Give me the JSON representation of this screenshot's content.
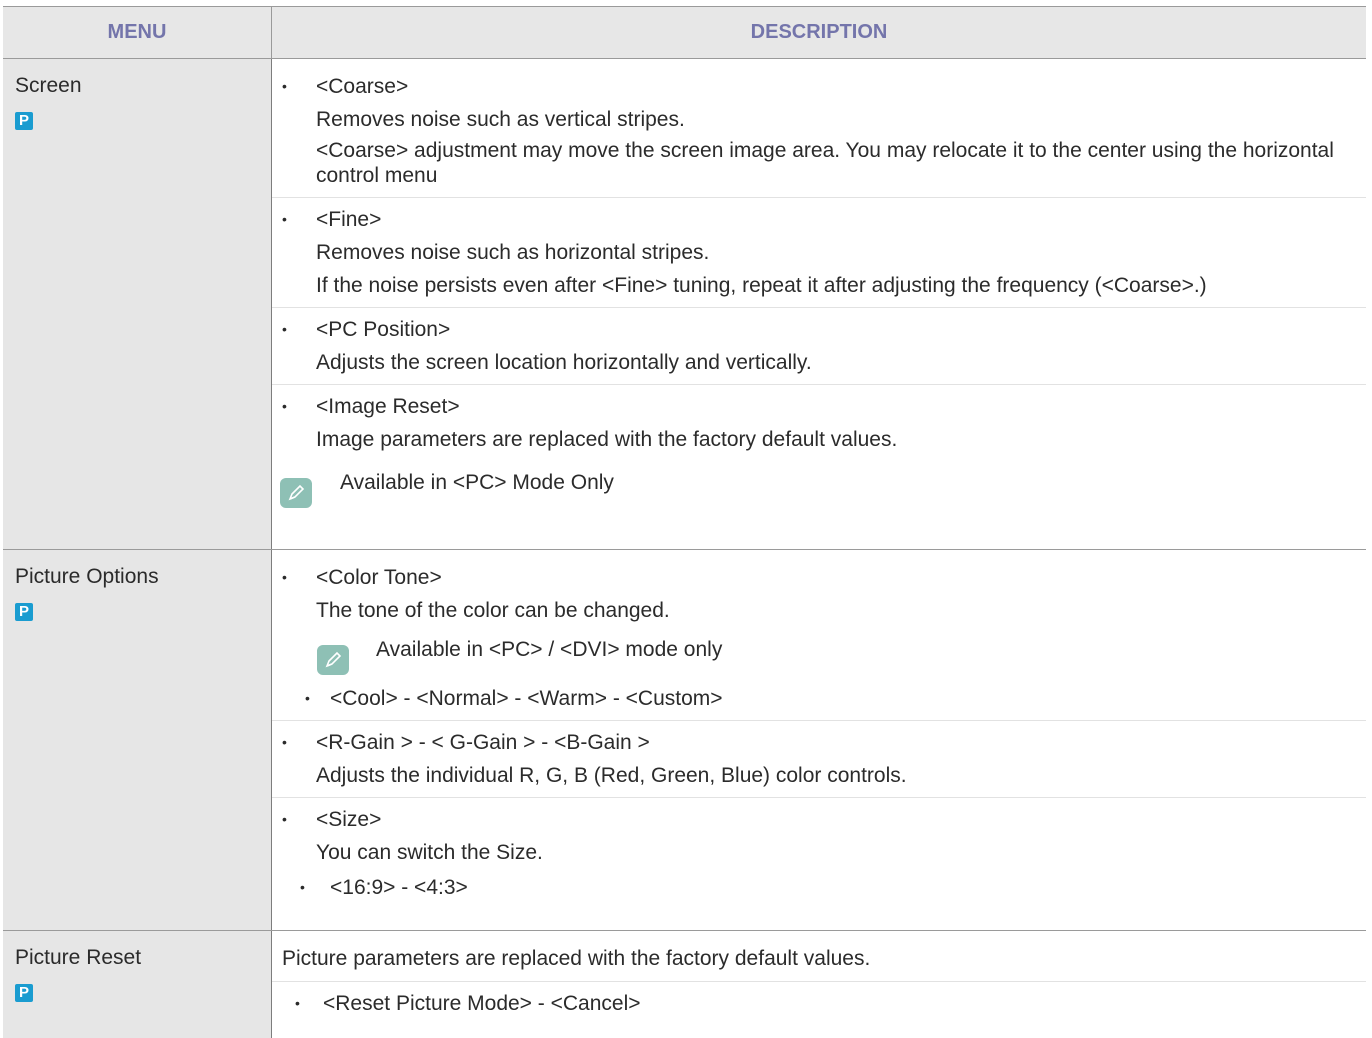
{
  "header": {
    "menu": "MENU",
    "description": "DESCRIPTION"
  },
  "rows": [
    {
      "menu": "Screen",
      "badge": "P",
      "items": [
        {
          "head": "<Coarse>",
          "lines": [
            "Removes noise such as vertical stripes.",
            "<Coarse> adjustment may move the screen image area. You may relocate it to the center using the horizontal control menu"
          ]
        },
        {
          "head": "<Fine>",
          "lines": [
            "Removes noise such as horizontal stripes.",
            "If the noise persists even after <Fine> tuning, repeat it after adjusting the frequency (<Coarse>.)"
          ]
        },
        {
          "head": "<PC Position>",
          "lines": [
            "Adjusts the screen location horizontally and vertically."
          ]
        },
        {
          "head": "<Image Reset>",
          "lines": [
            "Image parameters are replaced with the factory default values."
          ]
        }
      ],
      "note": "Available in <PC> Mode Only"
    },
    {
      "menu": "Picture Options",
      "badge": "P",
      "items": [
        {
          "head": "<Color Tone>",
          "lines": [
            "The tone of the color can be changed."
          ]
        },
        {
          "head": "<R-Gain > - < G-Gain > - <B-Gain >",
          "lines": [
            "Adjusts the individual R, G, B (Red, Green, Blue) color controls."
          ]
        },
        {
          "head": "<Size>",
          "lines": [
            " You can switch the Size."
          ]
        }
      ],
      "note": "Available in <PC> / <DVI> mode only",
      "tone_options": "<Cool> - <Normal> - <Warm> - <Custom>",
      "size_options": "<16:9> - <4:3>"
    },
    {
      "menu": "Picture Reset",
      "badge": "P",
      "text": "Picture parameters are replaced with the factory default values.",
      "options": "<Reset Picture Mode> - <Cancel>"
    }
  ],
  "icons": {
    "badge": "p-badge-icon",
    "note": "pencil-note-icon"
  },
  "colors": {
    "header_text": "#7475ab",
    "header_bg": "#e7e7e7",
    "badge": "#1a9cd0",
    "note_icon": "#8ec0b5"
  }
}
